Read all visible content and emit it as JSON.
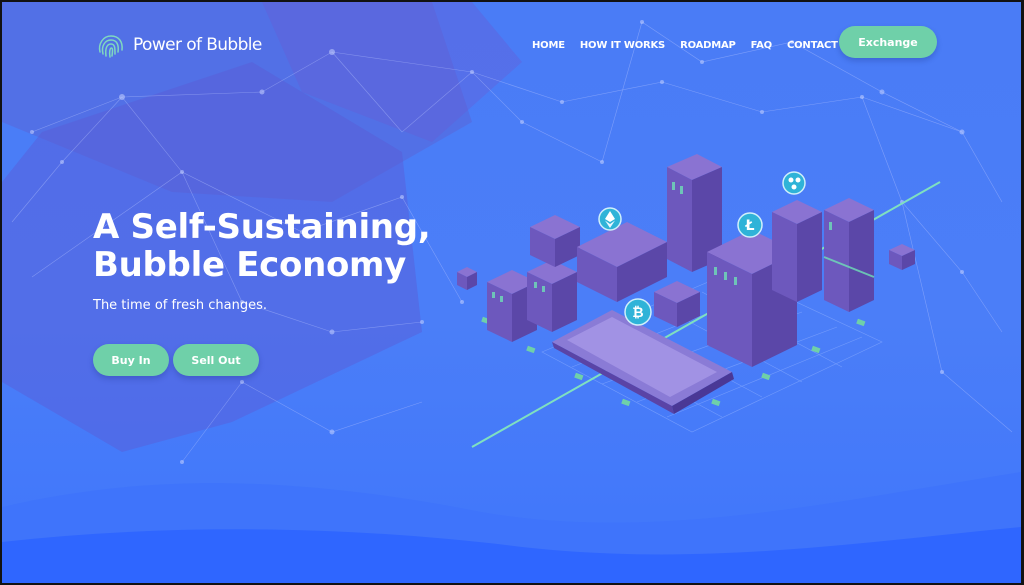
{
  "brand": {
    "name": "Power of Bubble",
    "logo_icon": "fingerprint-icon"
  },
  "nav": {
    "items": [
      "HOME",
      "HOW IT WORKS",
      "ROADMAP",
      "FAQ",
      "CONTACT"
    ],
    "exchange_label": "Exchange"
  },
  "hero": {
    "title_line1": "A Self-Sustaining,",
    "title_line2": "Bubble Economy",
    "subtitle": "The time of fresh changes.",
    "buy_label": "Buy In",
    "sell_label": "Sell Out"
  },
  "illustration": {
    "icons": [
      "ethereum-coin-icon",
      "litecoin-coin-icon",
      "bitcoin-coin-icon",
      "ripple-coin-icon"
    ]
  },
  "colors": {
    "background": "#4a7cf6",
    "wave": "#2f6bff",
    "accent_green": "#6fd0a9",
    "building_purple": "#6a56b8"
  }
}
